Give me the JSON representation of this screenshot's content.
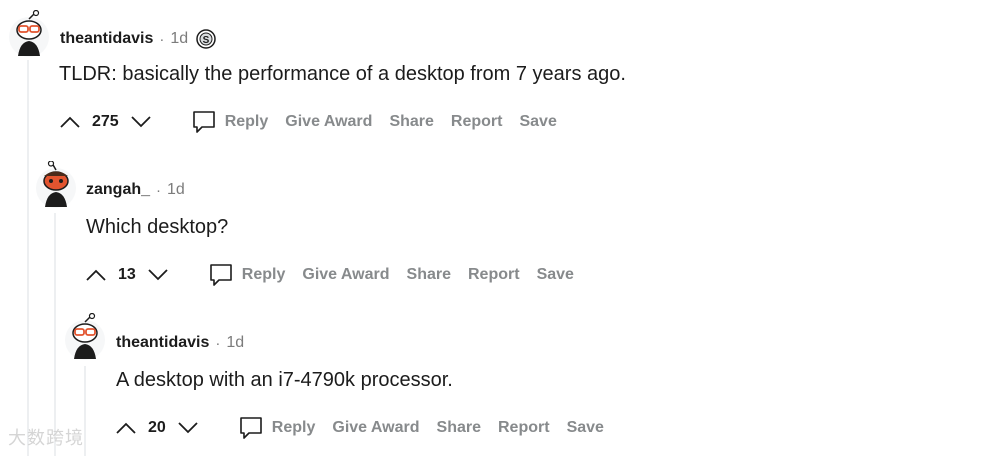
{
  "comments": [
    {
      "username": "theantidavis",
      "separator": "·",
      "time": "1d",
      "badge": "S",
      "text": "TLDR: basically the performance of a desktop from 7 years ago.",
      "score": "275",
      "actions": {
        "reply": "Reply",
        "give_award": "Give Award",
        "share": "Share",
        "report": "Report",
        "save": "Save"
      }
    },
    {
      "username": "zangah_",
      "separator": "·",
      "time": "1d",
      "text": "Which desktop?",
      "score": "13",
      "actions": {
        "reply": "Reply",
        "give_award": "Give Award",
        "share": "Share",
        "report": "Report",
        "save": "Save"
      }
    },
    {
      "username": "theantidavis",
      "separator": "·",
      "time": "1d",
      "text": "A desktop with an i7-4790k processor.",
      "score": "20",
      "actions": {
        "reply": "Reply",
        "give_award": "Give Award",
        "share": "Share",
        "report": "Report",
        "save": "Save"
      }
    }
  ],
  "watermark": "大数跨境",
  "colors": {
    "text": "#1c1c1c",
    "meta": "#7c7c7c",
    "action": "#878a8c",
    "thread_line": "#edeff1",
    "avatar_orange": "#e2542f"
  },
  "icons": {
    "upvote": "arrow-up-icon",
    "downvote": "arrow-down-icon",
    "reply": "speech-bubble-icon",
    "badge": "silver-coin-icon"
  }
}
